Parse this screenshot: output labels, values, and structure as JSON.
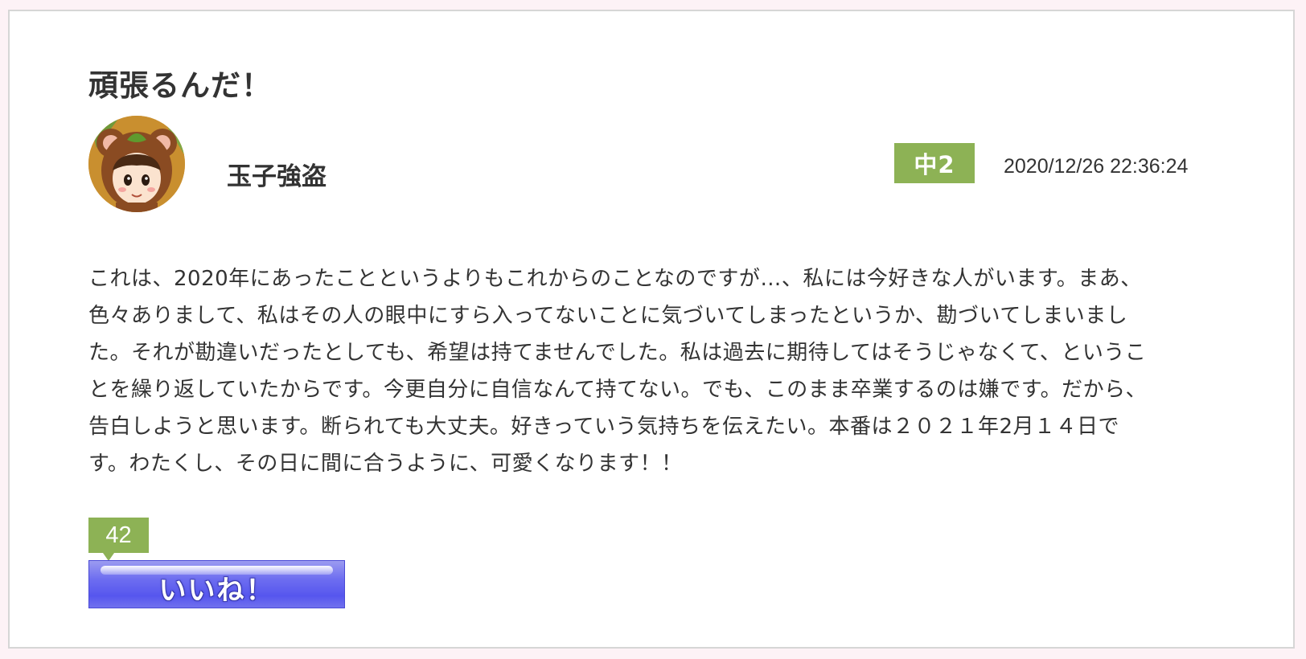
{
  "post": {
    "title": "頑張るんだ！",
    "author": "玉子強盗",
    "grade_badge": "中2",
    "timestamp": "2020/12/26 22:36:24",
    "body": "これは、2020年にあったことというよりもこれからのことなのですが…、私には今好きな人がいます。まあ、\n色々ありまして、私はその人の眼中にすら入ってないことに気づいてしまったというか、勘づいてしまいまし\nた。それが勘違いだったとしても、希望は持てませんでした。私は過去に期待してはそうじゃなくて、というこ\nとを繰り返していたからです。今更自分に自信なんて持てない。でも、このまま卒業するのは嫌です。だから、\n告白しようと思います。断られても大丈夫。好きっていう気持ちを伝えたい。本番は２０２１年2月１４日で\nす。わたくし、その日に間に合うように、可愛くなります！！"
  },
  "like": {
    "count": "42",
    "button_label": "いいね！"
  },
  "colors": {
    "badge_green": "#8db255",
    "like_button_blue": "#5f5fef",
    "page_background": "#fdf2f6"
  },
  "icons": {
    "avatar": "bear-hood-girl-avatar"
  }
}
